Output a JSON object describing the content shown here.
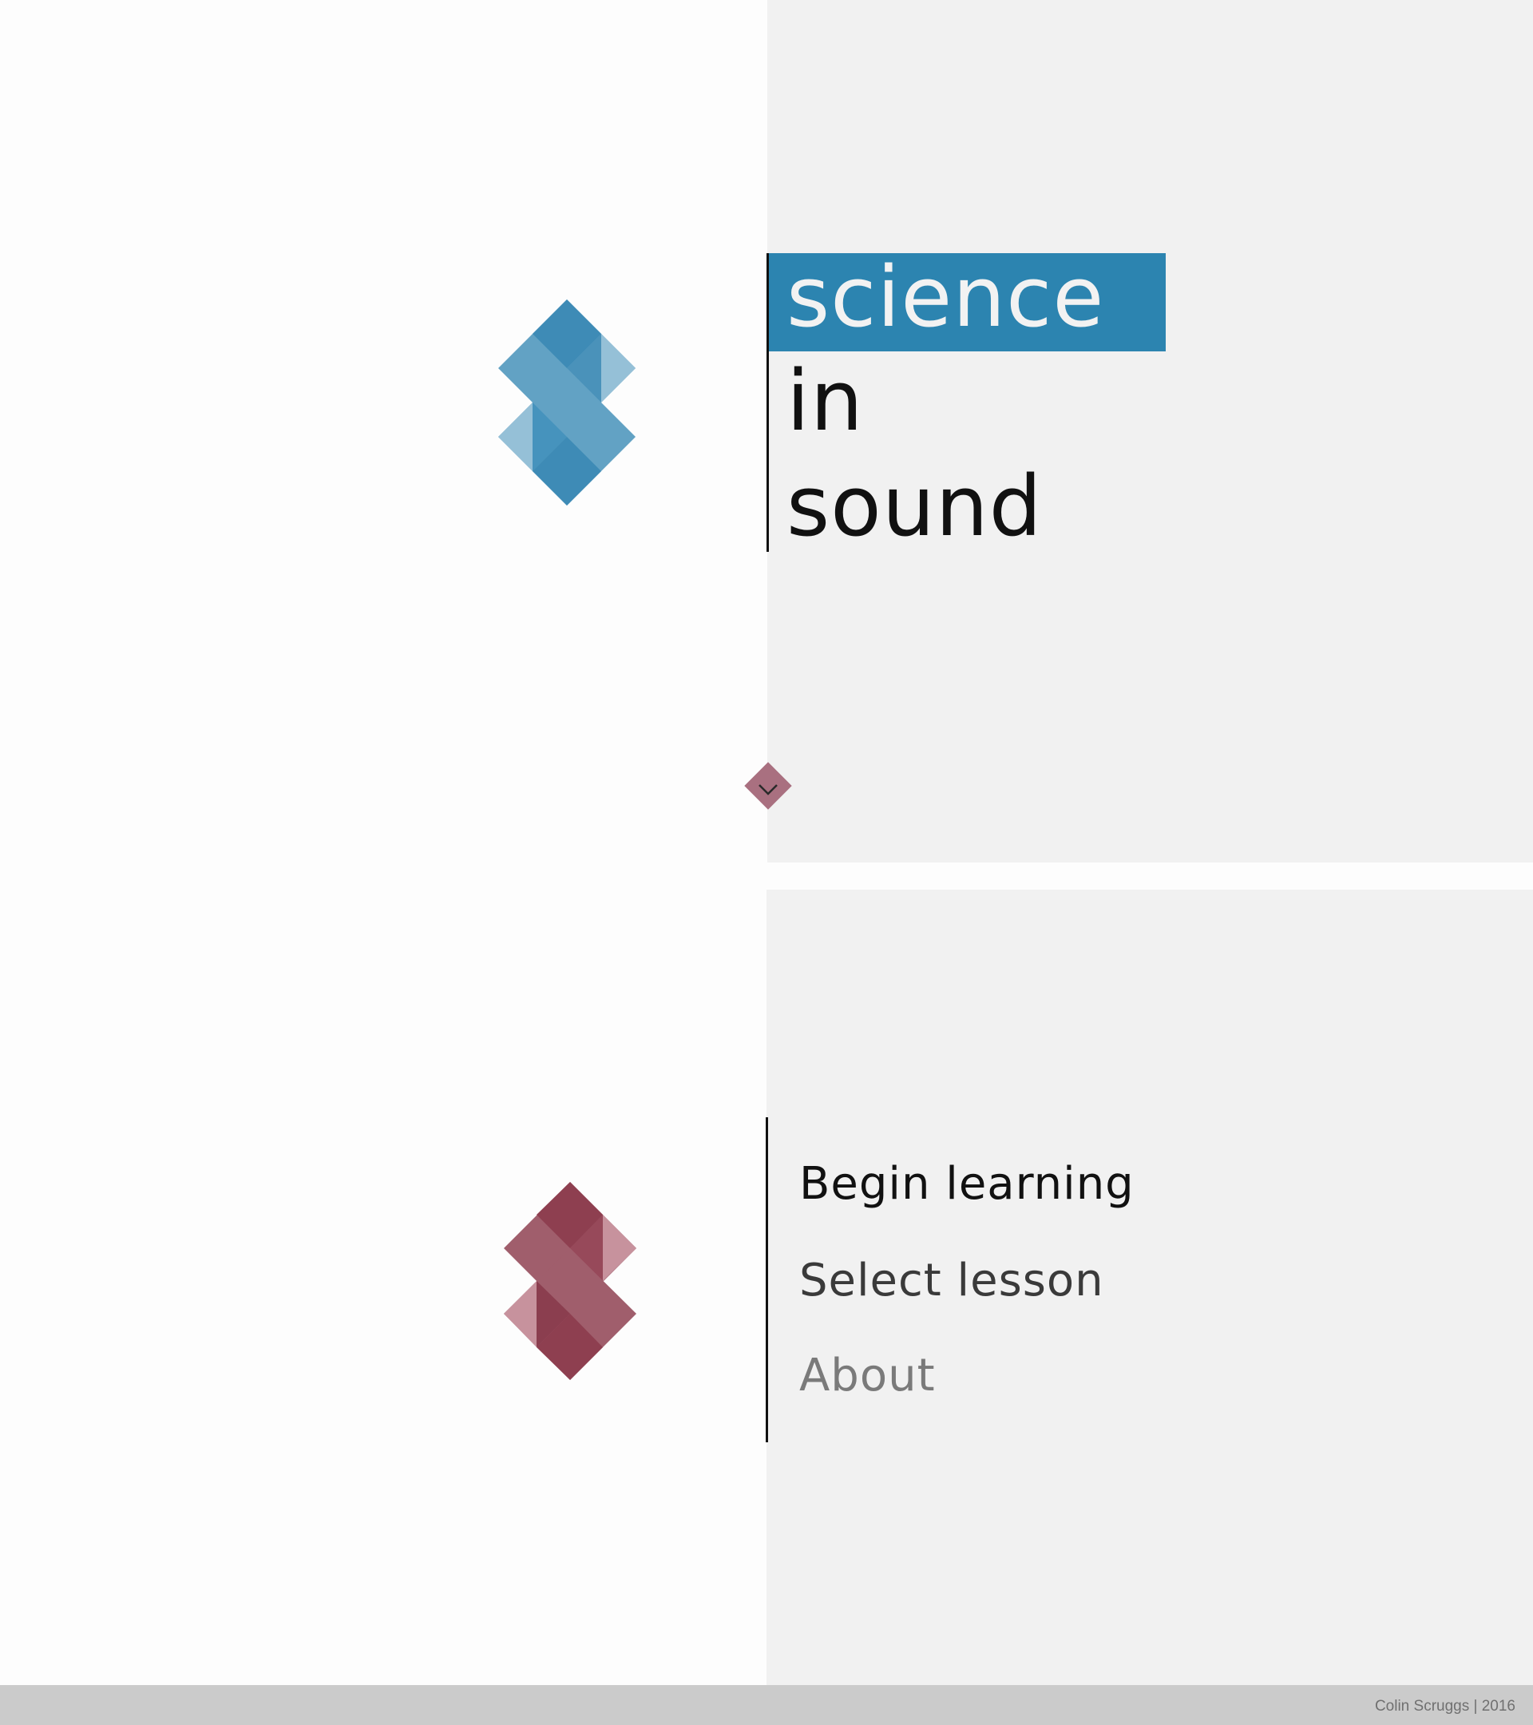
{
  "colors": {
    "page_background": "#fdfdfd",
    "panel_background": "#f1f1f1",
    "title_highlight": "#2c84b0",
    "logo_blue": "#3f8fb9",
    "logo_red": "#8e3f50",
    "scroll_diamond": "#a97080",
    "footer_background": "#cbcbcb"
  },
  "hero": {
    "logo_icon": "geometric-s-logo-blue",
    "title": {
      "line1": "science",
      "line2": "in",
      "line3": "sound"
    },
    "scroll_icon": "chevron-down-icon"
  },
  "menu": {
    "logo_icon": "geometric-s-logo-red",
    "items": [
      {
        "label": "Begin learning"
      },
      {
        "label": "Select lesson"
      },
      {
        "label": "About"
      }
    ]
  },
  "footer": {
    "credit": "Colin Scruggs | 2016"
  }
}
